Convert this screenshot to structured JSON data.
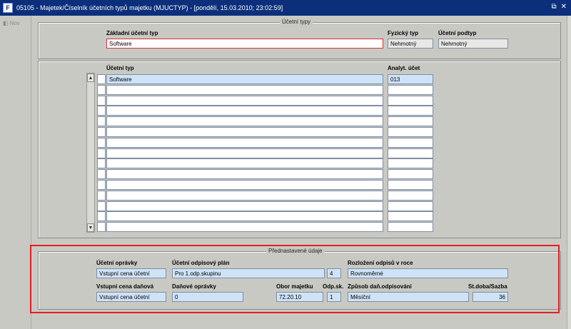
{
  "window": {
    "title": "05105 - Majetek/Číselník účetních typů majetku (MJUCTYP) - [pondělí, 15.03.2010; 23:02:59]",
    "icon_letter": "F",
    "buttons": [
      "restore-icon",
      "close-icon"
    ]
  },
  "leftnav": {
    "new_label": "Nov"
  },
  "ucetni_typy": {
    "group_title": "Účetní typy",
    "zakladni_ucetni_typ_label": "Základní účetní typ",
    "zakladni_ucetni_typ_value": "Software",
    "fyzicky_typ_label": "Fyzický typ",
    "fyzicky_typ_value": "Nehmotný",
    "ucetni_podtyp_label": "Účetní podtyp",
    "ucetni_podtyp_value": "Nehmotný",
    "table": {
      "col_ucetni_typ": "Účetní typ",
      "col_analyt_ucet": "Analyt. účet",
      "rows": [
        {
          "ucetni_typ": "Software",
          "analyt_ucet": "013"
        },
        {
          "ucetni_typ": "",
          "analyt_ucet": ""
        },
        {
          "ucetni_typ": "",
          "analyt_ucet": ""
        },
        {
          "ucetni_typ": "",
          "analyt_ucet": ""
        },
        {
          "ucetni_typ": "",
          "analyt_ucet": ""
        },
        {
          "ucetni_typ": "",
          "analyt_ucet": ""
        },
        {
          "ucetni_typ": "",
          "analyt_ucet": ""
        },
        {
          "ucetni_typ": "",
          "analyt_ucet": ""
        },
        {
          "ucetni_typ": "",
          "analyt_ucet": ""
        },
        {
          "ucetni_typ": "",
          "analyt_ucet": ""
        },
        {
          "ucetni_typ": "",
          "analyt_ucet": ""
        },
        {
          "ucetni_typ": "",
          "analyt_ucet": ""
        },
        {
          "ucetni_typ": "",
          "analyt_ucet": ""
        },
        {
          "ucetni_typ": "",
          "analyt_ucet": ""
        },
        {
          "ucetni_typ": "",
          "analyt_ucet": ""
        }
      ]
    }
  },
  "prednastavene": {
    "group_title": "Přednastavené údaje",
    "ucetni_opravky_label": "Účetní oprávky",
    "ucetni_opravky_value": "Vstupní cena účetní",
    "ucetni_odpisovy_plan_label": "Účetní odpisový plán",
    "ucetni_odpisovy_plan_value": "Pro 1.odp.skupinu",
    "ucetni_odpisovy_plan_num": "4",
    "rozlozeni_label": "Rozložení odpisů v roce",
    "rozlozeni_value": "Rovnoměrné",
    "vstupni_cena_danova_label": "Vstupní cena daňová",
    "vstupni_cena_danova_value": "Vstupní cena účetní",
    "danove_opravky_label": "Daňové oprávky",
    "danove_opravky_value": "0",
    "obor_majetku_label": "Obor majetku",
    "obor_majetku_value": "72.20.10",
    "odp_sk_label": "Odp.sk.",
    "odp_sk_value": "1",
    "zpusob_label": "Způsob daň.odpisování",
    "zpusob_value": "Měsíční",
    "st_doba_label": "St.doba/Sazba",
    "st_doba_value": "36"
  },
  "colors": {
    "titlebar": "#0c2f7c",
    "field": "#cfe3f7",
    "highlight": "#e02020"
  }
}
